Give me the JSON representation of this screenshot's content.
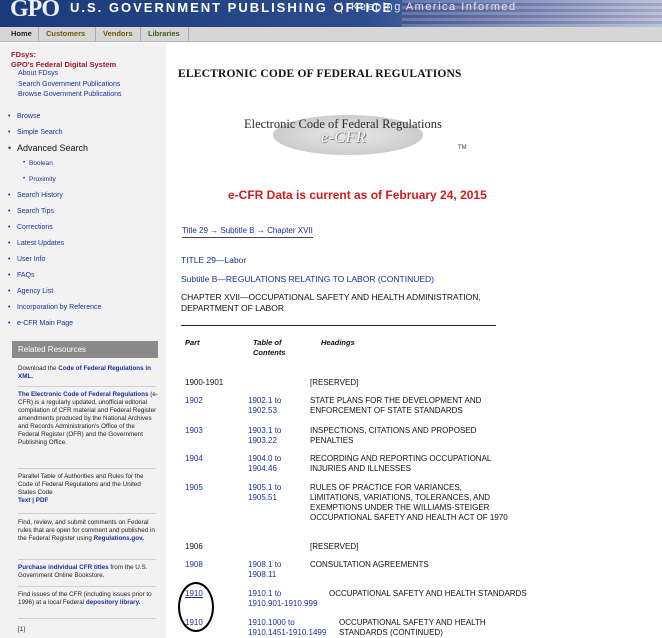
{
  "header": {
    "logo": "GPO",
    "agency": "U.S. GOVERNMENT PUBLISHING OFFICE",
    "separator": "|",
    "motto": "Keeping America Informed"
  },
  "topnav": [
    "Home",
    "Customers",
    "Vendors",
    "Libraries"
  ],
  "sidebar": {
    "fdsys_label": "FDsys:",
    "fdsys_title": "GPO's Federal Digital System",
    "fdsys_links": [
      "About FDsys",
      "Search Government Publications",
      "Browse Government Publications"
    ],
    "nav": {
      "browse": "Browse",
      "simple_search": "Simple Search",
      "advanced_search": "Advanced Search",
      "boolean": "Boolean",
      "proximity": "Proximity",
      "search_history": "Search History",
      "search_tips": "Search Tips",
      "corrections": "Corrections",
      "latest_updates": "Latest Updates",
      "user_info": "User Info",
      "faqs": "FAQs",
      "agency_list": "Agency List",
      "incorporation": "Incorporation by Reference",
      "ecfr_main": "e-CFR Main Page"
    },
    "related_title": "Related Resources",
    "related": {
      "r1_pre": "Download the ",
      "r1_link": "Code of Federal Regulations in XML.",
      "r2_link": "The Electronic Code of Federal Regulations",
      "r2_text": " (e-CFR) is a regularly updated, unofficial editorial compilation of CFR material and Federal Register amendments produced by the National Archives and Records Administration's Office of the Federal Register (OFR) and the Government Publishing Office.",
      "r3_text": "Parallel Table of Authorities and Rules for the Code of Federal Regulations and the United States Code",
      "r3_link": "Text | PDF",
      "r4_text": "Find, review, and submit comments on Federal rules that are open for comment and published in the Federal Register using ",
      "r4_link": "Regulations.gov.",
      "r5_link": "Purchase individual CFR titles",
      "r5_text": " from the U.S. Government Online Bookstore.",
      "r6_text": "Find issues of the CFR (including issues prior to 1996) at a local Federal ",
      "r6_link": "depository library.",
      "r7": "[1]"
    }
  },
  "main": {
    "page_title": "ELECTRONIC CODE OF FEDERAL REGULATIONS",
    "logo_line1": "Electronic Code of Federal Regulations",
    "logo_line2": "e-CFR",
    "logo_tm": "TM",
    "current_notice": "e-CFR Data is current as of February 24, 2015",
    "breadcrumb": "Title 29 → Subtitle B → Chapter XVII",
    "title": "TITLE 29—Labor",
    "subtitle": "Subtitle B—REGULATIONS RELATING TO LABOR (CONTINUED)",
    "chapter": "CHAPTER XVII—OCCUPATIONAL SAFETY AND HEALTH ADMINISTRATION, DEPARTMENT OF LABOR",
    "columns": {
      "part": "Part",
      "toc_1": "Table of",
      "toc_2": "Contents",
      "headings": "Headings"
    },
    "rows": [
      {
        "part": "1900-1901",
        "toc1": "",
        "toc2": "",
        "heading": "[RESERVED]"
      },
      {
        "part": "1902",
        "toc1": "1902.1 to",
        "toc2": "1902.53",
        "heading": "STATE PLANS FOR THE DEVELOPMENT AND ENFORCEMENT OF STATE STANDARDS"
      },
      {
        "part": "1903",
        "toc1": "1903.1 to",
        "toc2": "1903.22",
        "heading": "INSPECTIONS, CITATIONS AND PROPOSED PENALTIES"
      },
      {
        "part": "1904",
        "toc1": "1904.0 to",
        "toc2": "1904.46",
        "heading": "RECORDING AND REPORTING OCCUPATIONAL INJURIES AND ILLNESSES"
      },
      {
        "part": "1905",
        "toc1": "1905.1 to",
        "toc2": "1905.51",
        "heading": "RULES OF PRACTICE FOR VARIANCES, LIMITATIONS, VARIATIONS, TOLERANCES, AND EXEMPTIONS UNDER THE WILLIAMS-STEIGER OCCUPATIONAL SAFETY AND HEALTH ACT OF 1970"
      },
      {
        "part": "1906",
        "toc1": "",
        "toc2": "",
        "heading": "[RESERVED]"
      },
      {
        "part": "1908",
        "toc1": "1908.1 to",
        "toc2": "1908.11",
        "heading": "CONSULTATION AGREEMENTS"
      },
      {
        "part": "1910",
        "toc1": "1910.1 to",
        "toc2": "1910.901-1910.999",
        "heading": "OCCUPATIONAL SAFETY AND HEALTH STANDARDS"
      },
      {
        "part": "1910",
        "toc1": "1910.1000 to",
        "toc2": "1910.1451-1910.1499",
        "heading": "OCCUPATIONAL SAFETY AND HEALTH STANDARDS (CONTINUED)"
      }
    ]
  }
}
